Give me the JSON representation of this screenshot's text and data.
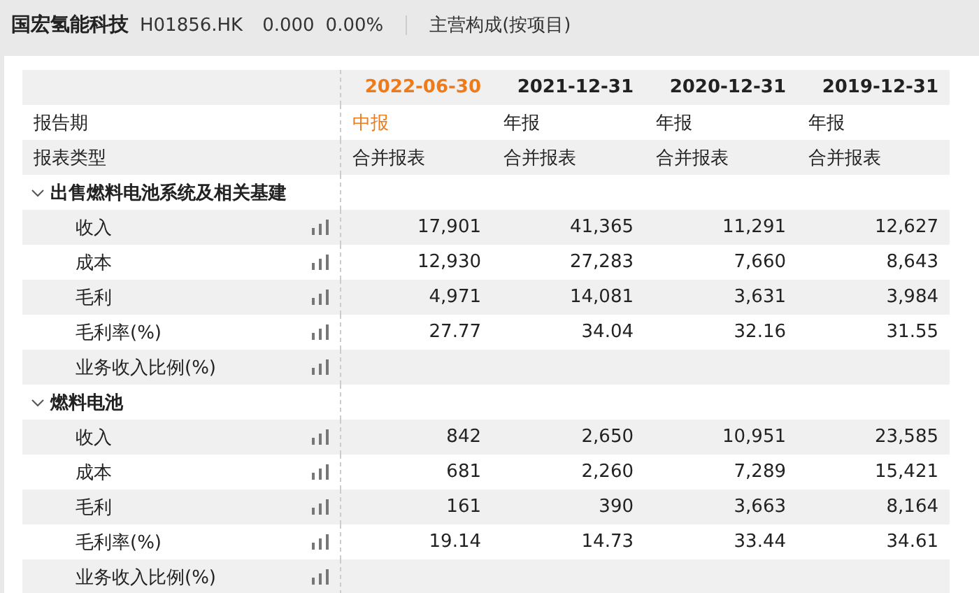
{
  "header": {
    "company": "国宏氢能科技",
    "code": "H01856.HK",
    "price": "0.000",
    "change": "0.00%",
    "section": "主营构成(按项目)"
  },
  "table": {
    "columns": [
      {
        "label": "2022-06-30",
        "selected": true
      },
      {
        "label": "2021-12-31",
        "selected": false
      },
      {
        "label": "2020-12-31",
        "selected": false
      },
      {
        "label": "2019-12-31",
        "selected": false
      }
    ],
    "info_rows": [
      {
        "label": "报告期",
        "values": [
          "中报",
          "年报",
          "年报",
          "年报"
        ]
      },
      {
        "label": "报表类型",
        "values": [
          "合并报表",
          "合并报表",
          "合并报表",
          "合并报表"
        ]
      }
    ],
    "groups": [
      {
        "label": "出售燃料电池系统及相关基建",
        "expanded": true,
        "rows": [
          {
            "label": "收入",
            "values": [
              "17,901",
              "41,365",
              "11,291",
              "12,627"
            ]
          },
          {
            "label": "成本",
            "values": [
              "12,930",
              "27,283",
              "7,660",
              "8,643"
            ]
          },
          {
            "label": "毛利",
            "values": [
              "4,971",
              "14,081",
              "3,631",
              "3,984"
            ]
          },
          {
            "label": "毛利率(%)",
            "values": [
              "27.77",
              "34.04",
              "32.16",
              "31.55"
            ]
          },
          {
            "label": "业务收入比例(%)",
            "values": []
          }
        ]
      },
      {
        "label": "燃料电池",
        "expanded": true,
        "rows": [
          {
            "label": "收入",
            "values": [
              "842",
              "2,650",
              "10,951",
              "23,585"
            ]
          },
          {
            "label": "成本",
            "values": [
              "681",
              "2,260",
              "7,289",
              "15,421"
            ]
          },
          {
            "label": "毛利",
            "values": [
              "161",
              "390",
              "3,663",
              "8,164"
            ]
          },
          {
            "label": "毛利率(%)",
            "values": [
              "19.14",
              "14.73",
              "33.44",
              "34.61"
            ]
          },
          {
            "label": "业务收入比例(%)",
            "values": []
          }
        ]
      }
    ]
  }
}
